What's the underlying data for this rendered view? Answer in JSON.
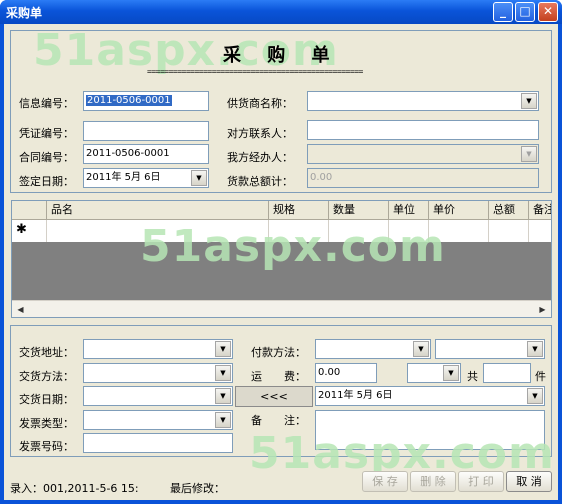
{
  "window": {
    "title": "采购单",
    "min_glyph": "_",
    "max_glyph": "□",
    "close_glyph": "✕"
  },
  "watermark": "51aspx.com",
  "header": {
    "title": "采 购 单",
    "rule": "=================================================="
  },
  "form": {
    "info_no_label": "信息编号：",
    "info_no_value": "2011-0506-0001",
    "voucher_no_label": "凭证编号：",
    "voucher_no_value": "",
    "contract_no_label": "合同编号：",
    "contract_no_value": "2011-0506-0001",
    "sign_date_label": "签定日期：",
    "sign_date_value": "2011年 5月 6日",
    "supplier_label": "供货商名称：",
    "supplier_value": "",
    "contact_label": "对方联系人：",
    "contact_value": "",
    "handler_label": "我方经办人：",
    "handler_value": "",
    "total_label": "货款总额计：",
    "total_value": "0.00"
  },
  "grid": {
    "columns": [
      "品名",
      "规格",
      "数量",
      "单位",
      "单价",
      "总额",
      "备注"
    ],
    "new_row_marker": "✱"
  },
  "delivery": {
    "address_label": "交货地址：",
    "method_label": "交货方法：",
    "date_label": "交货日期：",
    "invoice_type_label": "发票类型：",
    "invoice_no_label": "发票号码：",
    "payment_label": "付款方法：",
    "freight_label": "运　　费：",
    "freight_value": "0.00",
    "gong_label": "共",
    "jian_label": "件",
    "back_button": "<<<",
    "date2_value": "2011年 5月 6日",
    "remark_label": "备　　注："
  },
  "status": {
    "entry": "录入：001,2011-5-6 15:",
    "last_modified": "最后修改："
  },
  "buttons": {
    "save": "保 存",
    "delete": "删 除",
    "print": "打 印",
    "cancel": "取 消"
  }
}
